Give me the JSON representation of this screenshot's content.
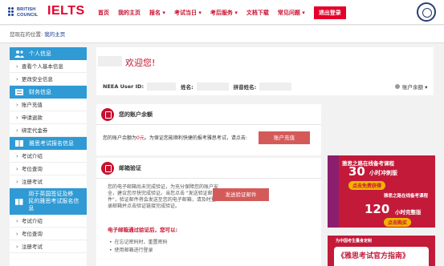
{
  "header": {
    "logo_bc_line1": "BRITISH",
    "logo_bc_line2": "COUNCIL",
    "logo_ielts": "IELTS",
    "nav": [
      "首页",
      "我的主页",
      "报名 ▾",
      "考试当日 ▾",
      "考后服务 ▾",
      "文档下载",
      "常见问题 ▾"
    ],
    "login_button": "退出登录"
  },
  "breadcrumb": {
    "prefix": "您现在的位置:",
    "current": "我的主页"
  },
  "sidebar": {
    "section1": "个人信息",
    "section1_items": [
      "查看个人基本信息",
      "更改安全信息"
    ],
    "section2": "财务信息",
    "section2_items": [
      "账户充值",
      "申请退款",
      "绑定代金券"
    ],
    "section3": "雅思考试报名信息",
    "section3_items": [
      "考试介绍",
      "考位查询",
      "注册考试"
    ],
    "section4_line1": "用于英国签证及移",
    "section4_line2": "民的雅思考试报名信息",
    "section4_items": [
      "考试介绍",
      "考位查询",
      "注册考试"
    ]
  },
  "main": {
    "welcome": "欢迎您!",
    "user_id_label": "NEEA User ID:",
    "name_label": "姓名:",
    "pinyin_label": "拼音姓名:",
    "account_dropdown": "账户余额 ▾",
    "balance_title": "您的账户余额",
    "balance_text_prefix": "您的账户余额为",
    "balance_amount": "0元",
    "balance_text_suffix": "。为保证您能顺利快捷的报考雅思考试，请点击:",
    "recharge_button": "账户充值",
    "email_title": "邮箱验证",
    "email_text": "您的电子邮箱尚未完成验证，为充分保障您的账户安全，建议您尽快完成验证。当您点击 \"发送验证邮件\"，验证邮件将会发送至您的电子邮箱，请及时登录邮箱并点击验证链接完成验证。",
    "send_button": "发送验证邮件",
    "email_warn": "电子邮箱通过验证后，您可以:",
    "email_benefits": [
      "在忘记密码时，重置密码",
      "使用邮箱进行登录"
    ]
  },
  "ads": {
    "ad1_line1": "雅思之路在线备考课程",
    "ad1_big1": "30",
    "ad1_unit1": "小时冲刺版",
    "ad1_pill1": "点击免费获得",
    "ad1_line2": "雅思之路在线备考课程",
    "ad1_big2": "120",
    "ad1_unit2": "小时完整版",
    "ad1_pill2": "点击购买",
    "ad2_top": "为中国考生量身定制",
    "ad2_main": "《雅思考试官方指南》"
  }
}
